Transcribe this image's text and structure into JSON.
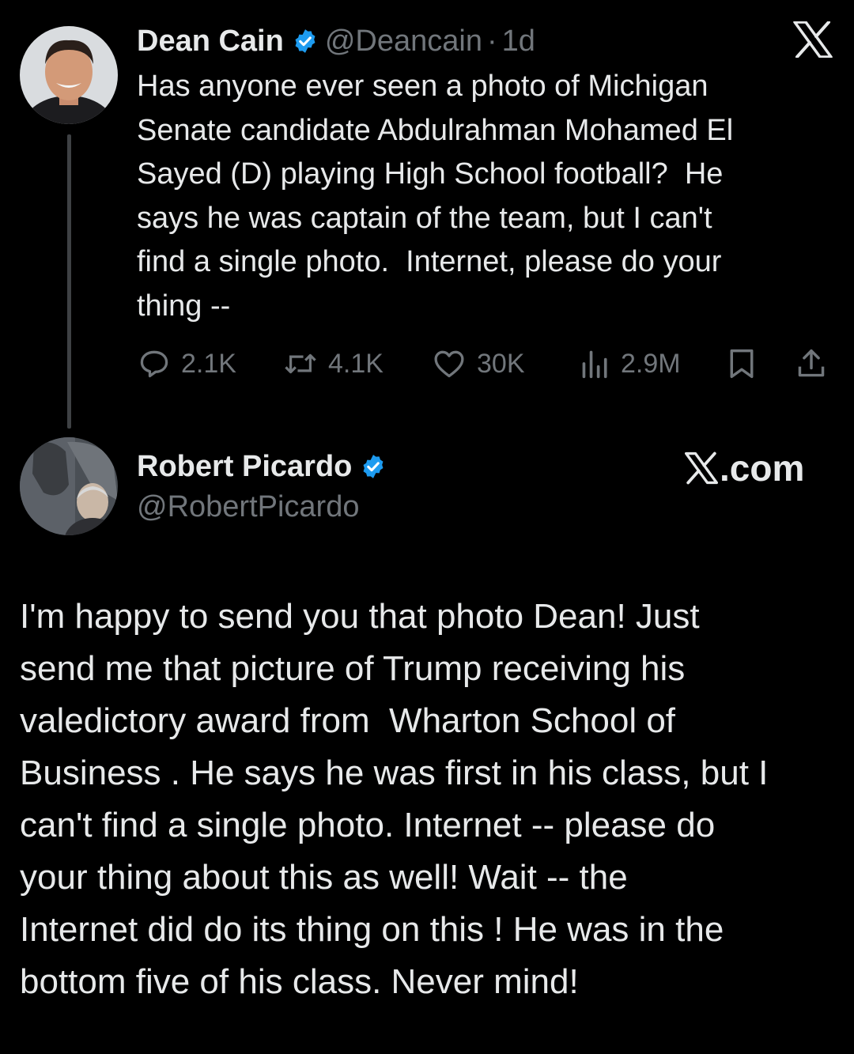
{
  "tweet1": {
    "author_name": "Dean Cain",
    "handle": "@Deancain",
    "time": "1d",
    "text": "Has anyone ever seen a photo of Michigan\nSenate candidate Abdulrahman Mohamed El\nSayed (D) playing High School football?  He\nsays he was captain of the team, but I can't\nfind a single photo.  Internet, please do your\nthing --",
    "replies": "2.1K",
    "retweets": "4.1K",
    "likes": "30K",
    "views": "2.9M"
  },
  "tweet2": {
    "author_name": "Robert Picardo",
    "handle": "@RobertPicardo",
    "site_label": ".com",
    "text": "I'm happy to send you that photo Dean! Just\nsend me that picture of Trump receiving his\nvaledictory award from  Wharton School of\nBusiness . He says he was first in his class, but I\ncan't find a single photo. Internet -- please do\nyour thing about this as well! Wait -- the\nInternet did do its thing on this ! He was in the\nbottom five of his class. Never mind!"
  },
  "icons": {
    "verified": "verified-badge-icon",
    "x_logo": "x-logo-icon",
    "reply": "reply-icon",
    "retweet": "retweet-icon",
    "like": "heart-icon",
    "views": "views-icon",
    "bookmark": "bookmark-icon",
    "share": "share-icon"
  },
  "colors": {
    "background": "#000000",
    "text": "#e7e9ea",
    "muted": "#71767b",
    "verified": "#1d9bf0",
    "thread_line": "#3e4144"
  }
}
